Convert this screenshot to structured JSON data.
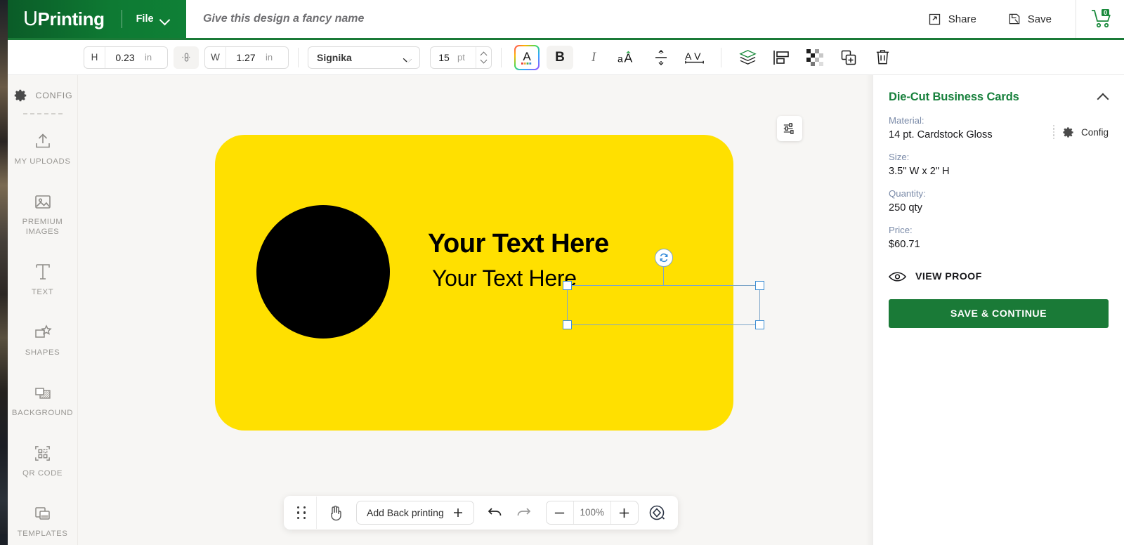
{
  "header": {
    "logo_u": "U",
    "logo_rest": "Printing",
    "file_menu": "File",
    "design_name_placeholder": "Give this design a fancy name",
    "share": "Share",
    "save": "Save",
    "cart_count": "0",
    "brand_green": "#0e7a33"
  },
  "toolbar": {
    "height_label": "H",
    "height_value": "0.23",
    "height_unit": "in",
    "width_label": "W",
    "width_value": "1.27",
    "width_unit": "in",
    "font_family": "Signika",
    "font_size": "15",
    "font_size_unit": "pt",
    "bold": "B",
    "italic": "I",
    "text_color_glyph": "A"
  },
  "sidebar": {
    "config_label": "CONFIG",
    "items": [
      {
        "label": "MY UPLOADS",
        "icon": "upload-icon"
      },
      {
        "label": "PREMIUM IMAGES",
        "icon": "image-icon"
      },
      {
        "label": "TEXT",
        "icon": "text-icon"
      },
      {
        "label": "SHAPES",
        "icon": "shapes-icon"
      },
      {
        "label": "BACKGROUND",
        "icon": "background-icon"
      },
      {
        "label": "QR CODE",
        "icon": "qr-code-icon"
      },
      {
        "label": "TEMPLATES",
        "icon": "templates-icon"
      }
    ]
  },
  "canvas": {
    "card_color": "#FFE000",
    "shape_color": "#000000",
    "text_primary": "Your Text Here",
    "text_secondary": "Your Text Here"
  },
  "bottombar": {
    "add_back_printing": "Add Back printing",
    "zoom_level": "100%"
  },
  "right_panel": {
    "title": "Die-Cut Business Cards",
    "config_label": "Config",
    "rows": [
      {
        "key": "Material:",
        "value": "14 pt. Cardstock Gloss"
      },
      {
        "key": "Size:",
        "value": "3.5\" W x 2\" H"
      },
      {
        "key": "Quantity:",
        "value": "250 qty"
      },
      {
        "key": "Price:",
        "value": "$60.71"
      }
    ],
    "view_proof": "VIEW PROOF",
    "save_continue": "SAVE & CONTINUE",
    "accent_green": "#17803c"
  }
}
